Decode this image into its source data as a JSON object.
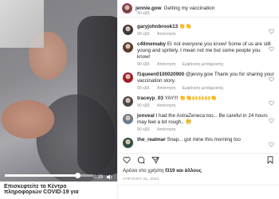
{
  "post": {
    "author": "jennie.gow",
    "caption": "Getting my vaccination",
    "age": "90 εβδ."
  },
  "video": {
    "time": "0:39",
    "progress": 0.82,
    "caption_line1": "Επισκεφτείτε το Κέντρο",
    "caption_line2": "πληροφοριών COVID-19 για"
  },
  "labels": {
    "reply": "Απάντηση",
    "view_translation": "Εμφάνιση μετάφρασης"
  },
  "comments": [
    {
      "user": "garyjohnbrook13",
      "text": "👏👏",
      "age": "90 εβδ.",
      "translate": false,
      "avatar_color": "#3a3a3a"
    },
    {
      "user": "c4llmemaby",
      "text": "Er not everyone you know! Some of us are still young and spritely. I mean not me but some people you know!",
      "age": "90 εβδ.",
      "translate": true,
      "avatar_color": "#5a3d2b"
    },
    {
      "user": "f1queen0100020900",
      "text": "@jenny.gow Thank you for sharing your vaccination story.",
      "age": "90 εβδ.",
      "translate": true,
      "avatar_color": "#a01e2c"
    },
    {
      "user": "traceyp_03",
      "text": "YAY!!! 👏👏🙌🙌🙌👏",
      "age": "90 εβδ.",
      "translate": false,
      "avatar_color": "#4a4a4a"
    },
    {
      "user": "jonveal",
      "text": "I had the AstraZeneca too... Be careful in 24 hours may feel a bit rough.. 😬",
      "age": "90 εβδ.",
      "translate": false,
      "avatar_color": "#6b7d8c"
    },
    {
      "user": "the_realmar",
      "text": "Snap... got mine this morning too",
      "age": "",
      "translate": false,
      "avatar_color": "#2f4f3f"
    }
  ],
  "likes": {
    "prefix": "Αρέσει στο χρήστη",
    "user": "f319",
    "suffix": "και άλλους"
  },
  "date": "ΑΠΡΙΛΙΟΥ 21, 2021"
}
